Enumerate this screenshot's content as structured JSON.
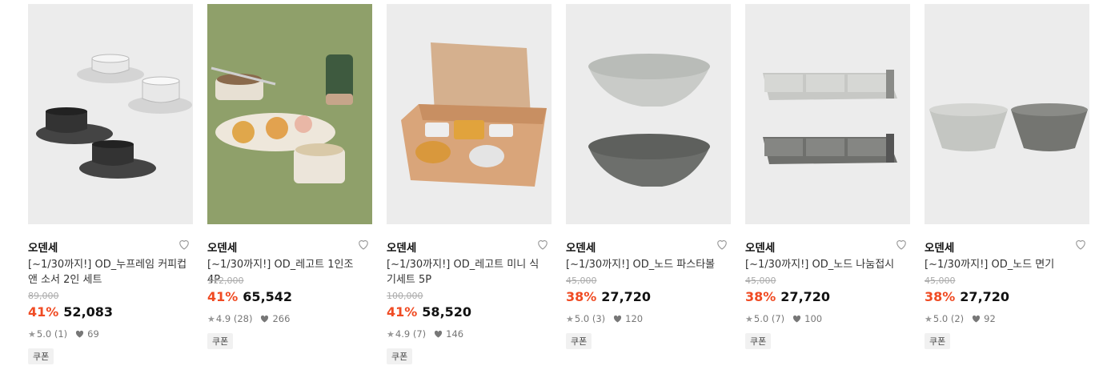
{
  "products": [
    {
      "brand": "오덴세",
      "title": "[~1/30까지!] OD_누프레임 커피컵 앤 소서 2인 세트",
      "original_price": "89,000",
      "discount": "41%",
      "price": "52,083",
      "rating": "5.0",
      "reviews": "(1)",
      "likes": "69",
      "coupon": "쿠폰",
      "image": "cup-and-saucer-set"
    },
    {
      "brand": "오덴세",
      "title": "[~1/30까지!] OD_레고트 1인조 4P",
      "original_price": "112,000",
      "discount": "41%",
      "price": "65,542",
      "rating": "4.9",
      "reviews": "(28)",
      "likes": "266",
      "coupon": "쿠폰",
      "image": "tableware-on-green"
    },
    {
      "brand": "오덴세",
      "title": "[~1/30까지!] OD_레고트 미니 식기세트 5P",
      "original_price": "100,000",
      "discount": "41%",
      "price": "58,520",
      "rating": "4.9",
      "reviews": "(7)",
      "likes": "146",
      "coupon": "쿠폰",
      "image": "gift-box-set"
    },
    {
      "brand": "오덴세",
      "title": "[~1/30까지!] OD_노드 파스타볼",
      "original_price": "45,000",
      "discount": "38%",
      "price": "27,720",
      "rating": "5.0",
      "reviews": "(3)",
      "likes": "120",
      "coupon": "쿠폰",
      "image": "pasta-bowls"
    },
    {
      "brand": "오덴세",
      "title": "[~1/30까지!] OD_노드 나눔접시",
      "original_price": "45,000",
      "discount": "38%",
      "price": "27,720",
      "rating": "5.0",
      "reviews": "(7)",
      "likes": "100",
      "coupon": "쿠폰",
      "image": "divided-plates"
    },
    {
      "brand": "오덴세",
      "title": "[~1/30까지!] OD_노드 면기",
      "original_price": "45,000",
      "discount": "38%",
      "price": "27,720",
      "rating": "5.0",
      "reviews": "(2)",
      "likes": "92",
      "coupon": "쿠폰",
      "image": "noodle-bowls"
    }
  ],
  "colors": {
    "discount": "#f04b23",
    "thumb_bg": "#ececec",
    "green_bg": "#8fa06a"
  }
}
